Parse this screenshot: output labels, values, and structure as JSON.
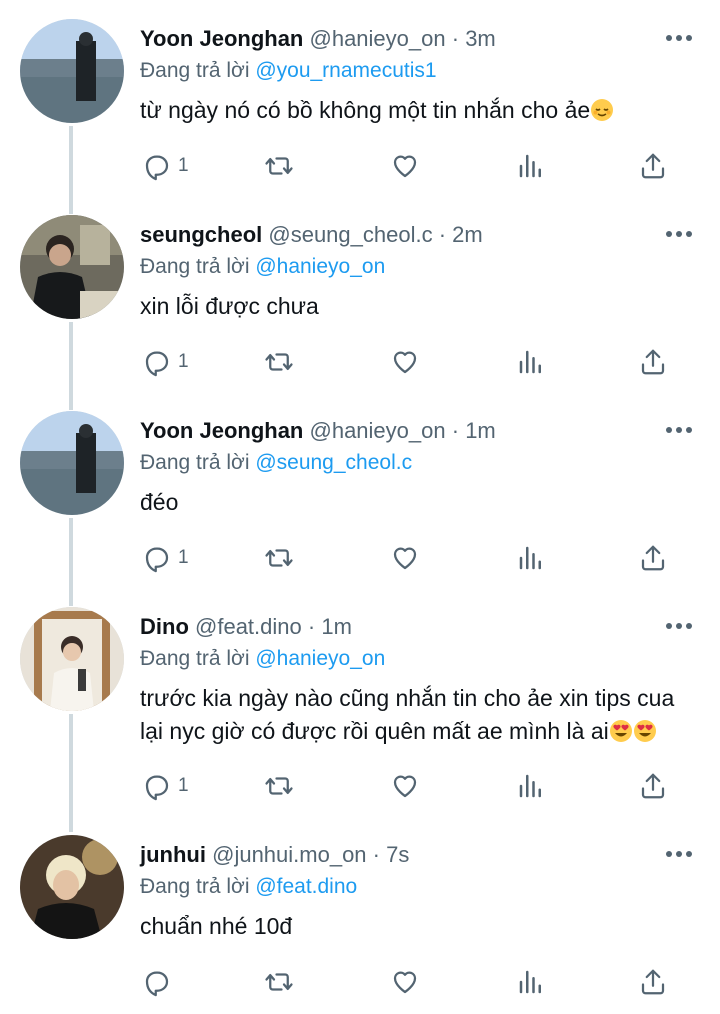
{
  "reply_prefix": "Đang trả lời",
  "tweets": [
    {
      "name": "Yoon Jeonghan",
      "handle": "@hanieyo_on",
      "dot": "·",
      "time": "3m",
      "reply_to": "@you_rnamecutis1",
      "text": "từ ngày nó có bồ không một tin nhắn cho ảe",
      "text_emoji": "relieved-face",
      "reply_count": "1",
      "avatar": "outdoor-lake-photo"
    },
    {
      "name": "seungcheol",
      "handle": "@seung_cheol.c",
      "dot": "·",
      "time": "2m",
      "reply_to": "@hanieyo_on",
      "text": "xin lỗi được chưa",
      "reply_count": "1",
      "avatar": "restaurant-photo"
    },
    {
      "name": "Yoon Jeonghan",
      "handle": "@hanieyo_on",
      "dot": "·",
      "time": "1m",
      "reply_to": "@seung_cheol.c",
      "text": "đéo",
      "reply_count": "1",
      "avatar": "outdoor-lake-photo"
    },
    {
      "name": "Dino",
      "handle": "@feat.dino",
      "dot": "·",
      "time": "1m",
      "reply_to": "@hanieyo_on",
      "text_line1": "trước kia ngày nào cũng nhắn tin cho ảe xin tips cua",
      "text_line2": "lại nyc giờ có được rồi quên mất ae mình là ai",
      "text_emoji": "heart-eyes-face",
      "reply_count": "1",
      "avatar": "mirror-photo"
    },
    {
      "name": "junhui",
      "handle": "@junhui.mo_on",
      "dot": "·",
      "time": "7s",
      "reply_to": "@feat.dino",
      "text": "chuẩn nhé 10đ",
      "reply_count": "",
      "avatar": "blond-portrait-photo"
    }
  ],
  "colors": {
    "text": "#0f1419",
    "secondary": "#536471",
    "mention": "#1d9bf0",
    "thread_line": "#cfd9de"
  }
}
